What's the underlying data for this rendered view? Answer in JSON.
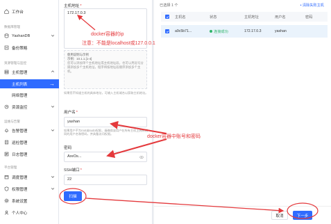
{
  "sidebar": {
    "workbench": "工作台",
    "group_db": "数据库管理",
    "yashandb": "YashanDB",
    "backup": "备份策略",
    "group_resource": "资源管理与监控",
    "host_mgmt": "主机管理",
    "host_list": "主机列表",
    "network_mgmt": "网络管理",
    "resource_monitor": "资源监控",
    "group_ops": "运维与告警",
    "alarm_mgmt": "告警管理",
    "inspection": "巡检管理",
    "logs": "日志管理",
    "group_platform": "平台管理",
    "scheduling": "调度管理",
    "permissions": "权限管理",
    "system_settings": "系统设置",
    "personal_center": "个人中心"
  },
  "form": {
    "host_label": "主机地址",
    "host_value": "172.17.0.3",
    "hint_title": "使用说明与示例",
    "hint_example": "示例：10.1.1.[1-4]",
    "hint_body": "您可以添加单个主机地址或主机地址段，也可以用逗号分隔添加多个主机地址，程序将按地址段顺序添加多个主机。",
    "hint_note": "如果您不知道主机的具体地址，可输入主机域名以获取主机地址。",
    "username_label": "用户名",
    "username_value": "yashan",
    "username_hint": "如果用户不为root或sudo权限，请确保该用户在所有主机上拥有相同的用户名和密码，并具备访问权限。",
    "password_label": "密码",
    "password_value": "AreOs...",
    "ssh_label": "SSH端口",
    "ssh_value": "22",
    "connect_button": "扫描"
  },
  "table": {
    "selected_text": "已选择 1 个",
    "clear_link": "清除失败主机",
    "columns": [
      "主机名",
      "状态",
      "主机地址",
      "用户名",
      "密码"
    ],
    "rows": [
      {
        "hostname": "a9c5b71...",
        "status": "连接成功",
        "address": "172.17.0.3",
        "username": "yashan",
        "password": ""
      }
    ]
  },
  "footer": {
    "cancel": "取消",
    "next": "下一步"
  },
  "annotations": {
    "docker_ip": "docker容器的ip",
    "note_localhost": "注意：不能是localhost或127.0.0.1",
    "account": "docker容器中账号和密码"
  },
  "colors": {
    "accent": "#2f6bff",
    "annotation": "#e4393c",
    "success": "#2fb56b"
  }
}
